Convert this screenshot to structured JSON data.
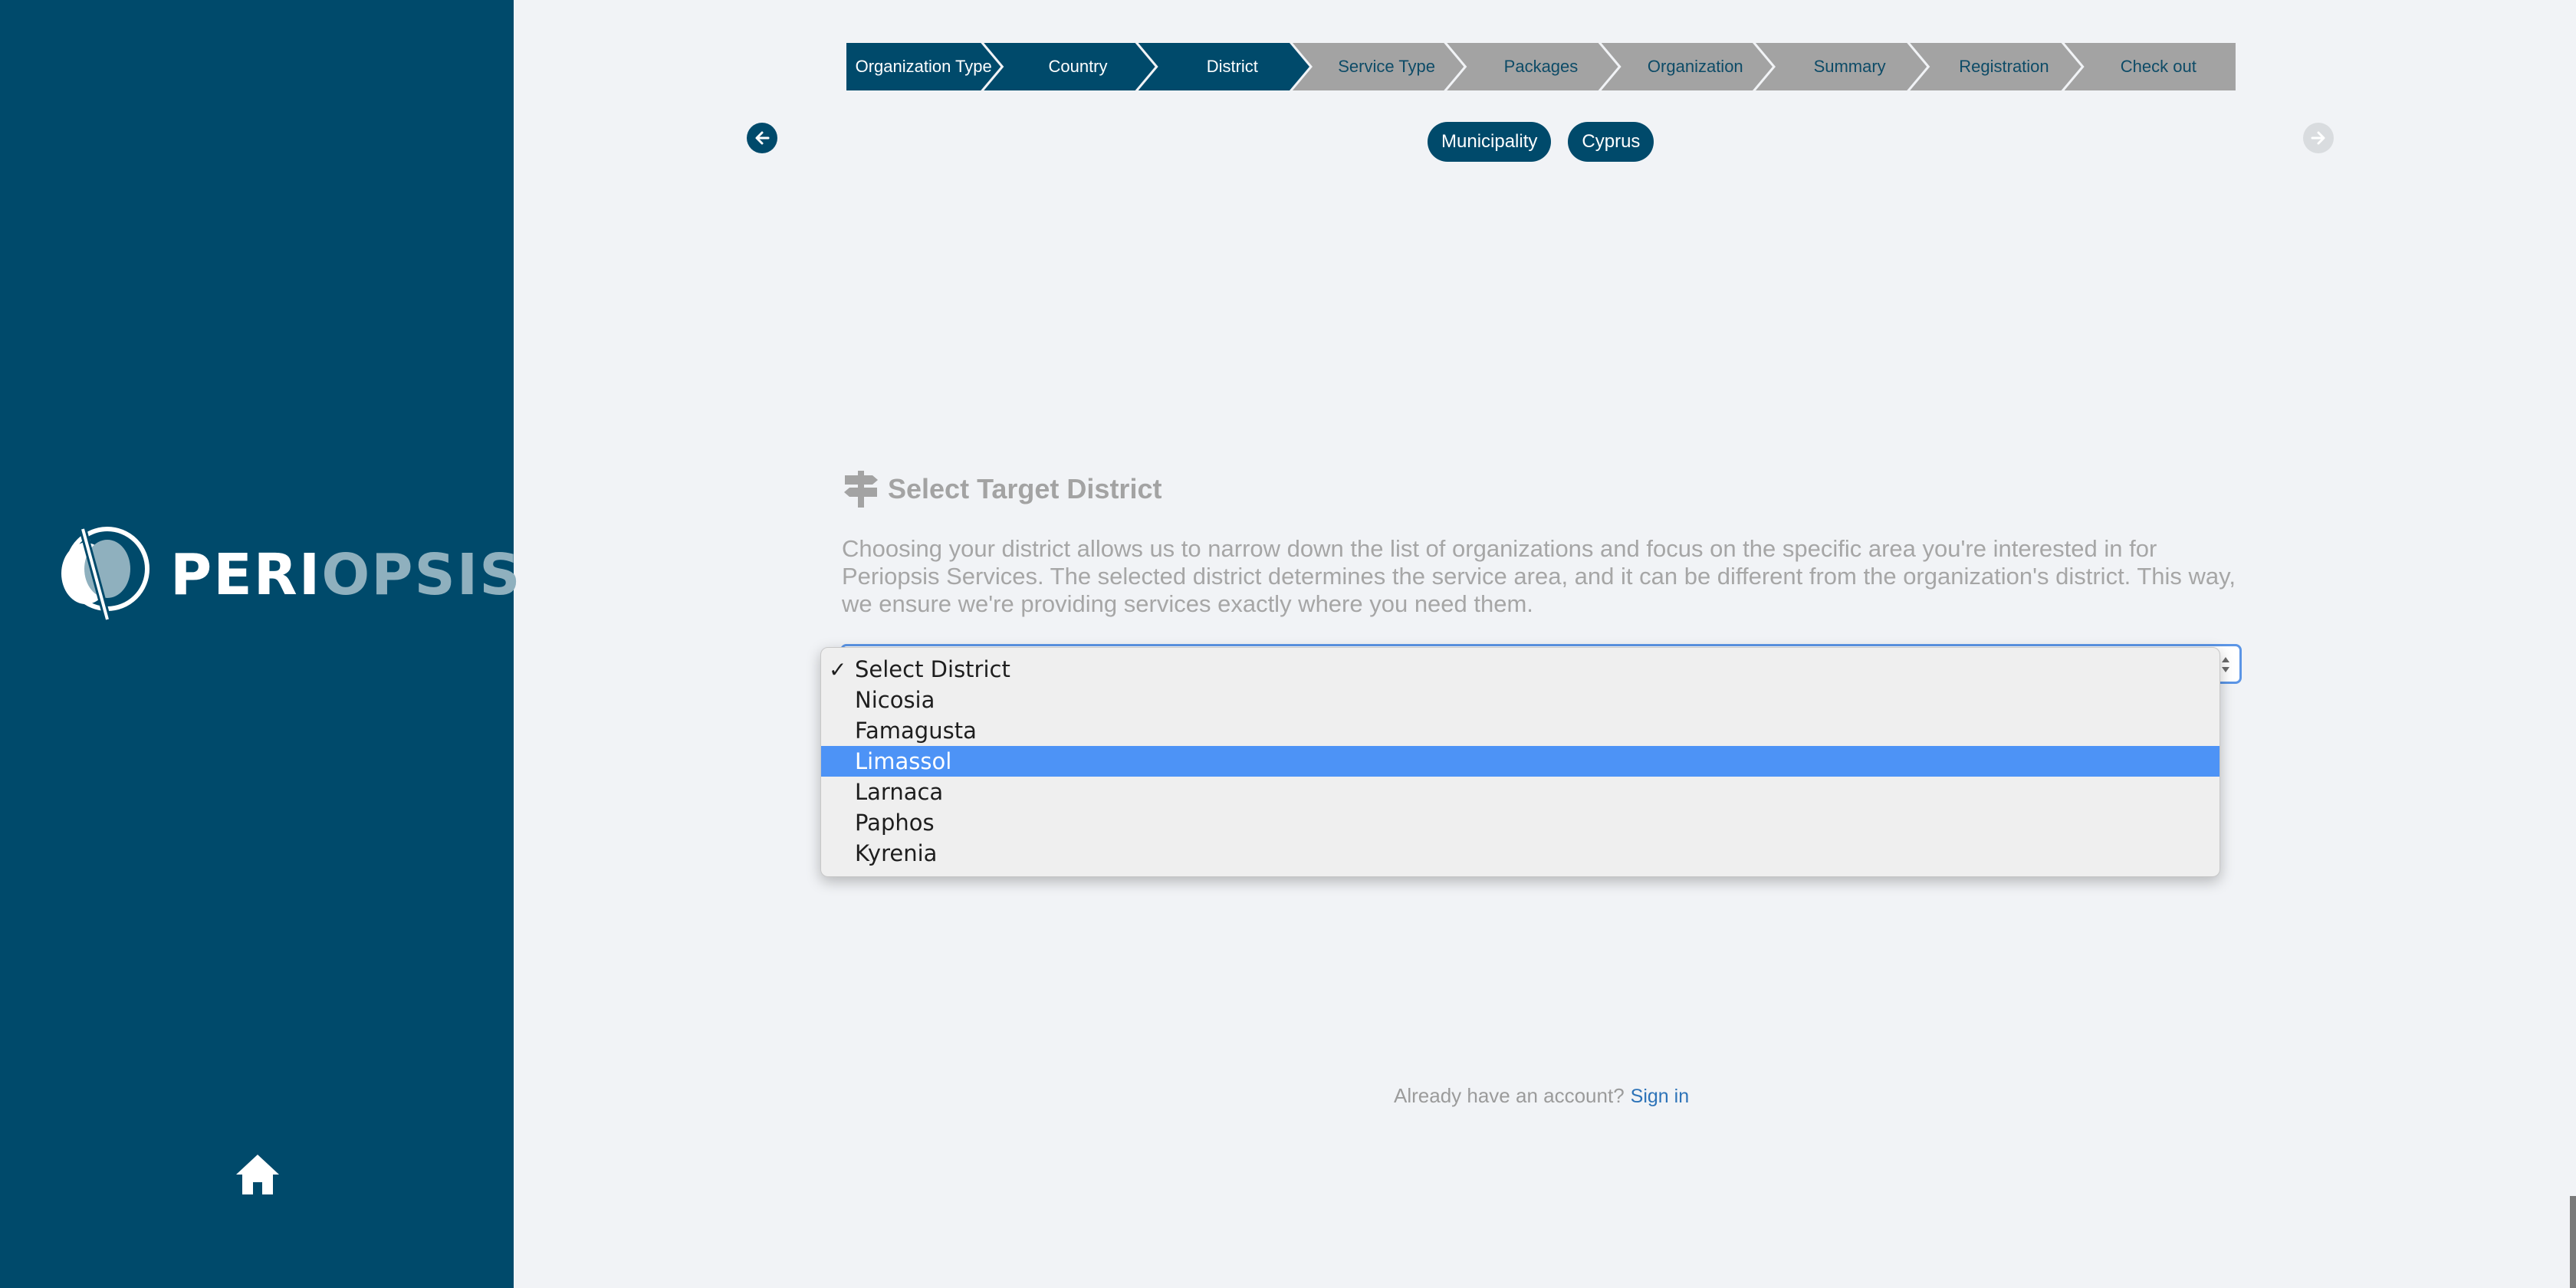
{
  "brand": {
    "name_part1": "PERI",
    "name_part2": "OPSIS",
    "primary_color": "#004a6b",
    "accent_color": "#8fb0be"
  },
  "stepper": {
    "steps": [
      {
        "label": "Organization Type",
        "state": "active"
      },
      {
        "label": "Country",
        "state": "active"
      },
      {
        "label": "District",
        "state": "active"
      },
      {
        "label": "Service Type",
        "state": "inactive"
      },
      {
        "label": "Packages",
        "state": "inactive"
      },
      {
        "label": "Organization",
        "state": "inactive"
      },
      {
        "label": "Summary",
        "state": "inactive"
      },
      {
        "label": "Registration",
        "state": "inactive"
      },
      {
        "label": "Check out",
        "state": "inactive"
      }
    ]
  },
  "nav": {
    "prev_icon": "arrow-left-icon",
    "next_icon": "arrow-right-icon",
    "next_enabled": false
  },
  "chips": [
    "Municipality",
    "Cyprus"
  ],
  "section": {
    "icon": "signpost-icon",
    "title": "Select Target District",
    "description": "Choosing your district allows us to narrow down the list of organizations and focus on the specific area you're interested in for Periopsis Services. The selected district determines the service area, and it can be different from the organization's district. This way, we ensure we're providing services exactly where you need them."
  },
  "district_select": {
    "selected": "Select District",
    "highlighted": "Limassol",
    "check_mark": "✓",
    "options": [
      "Select District",
      "Nicosia",
      "Famagusta",
      "Limassol",
      "Larnaca",
      "Paphos",
      "Kyrenia"
    ]
  },
  "footer": {
    "prompt": "Already have an account?",
    "link": "Sign in"
  },
  "sidebar": {
    "home_icon": "home-icon"
  }
}
